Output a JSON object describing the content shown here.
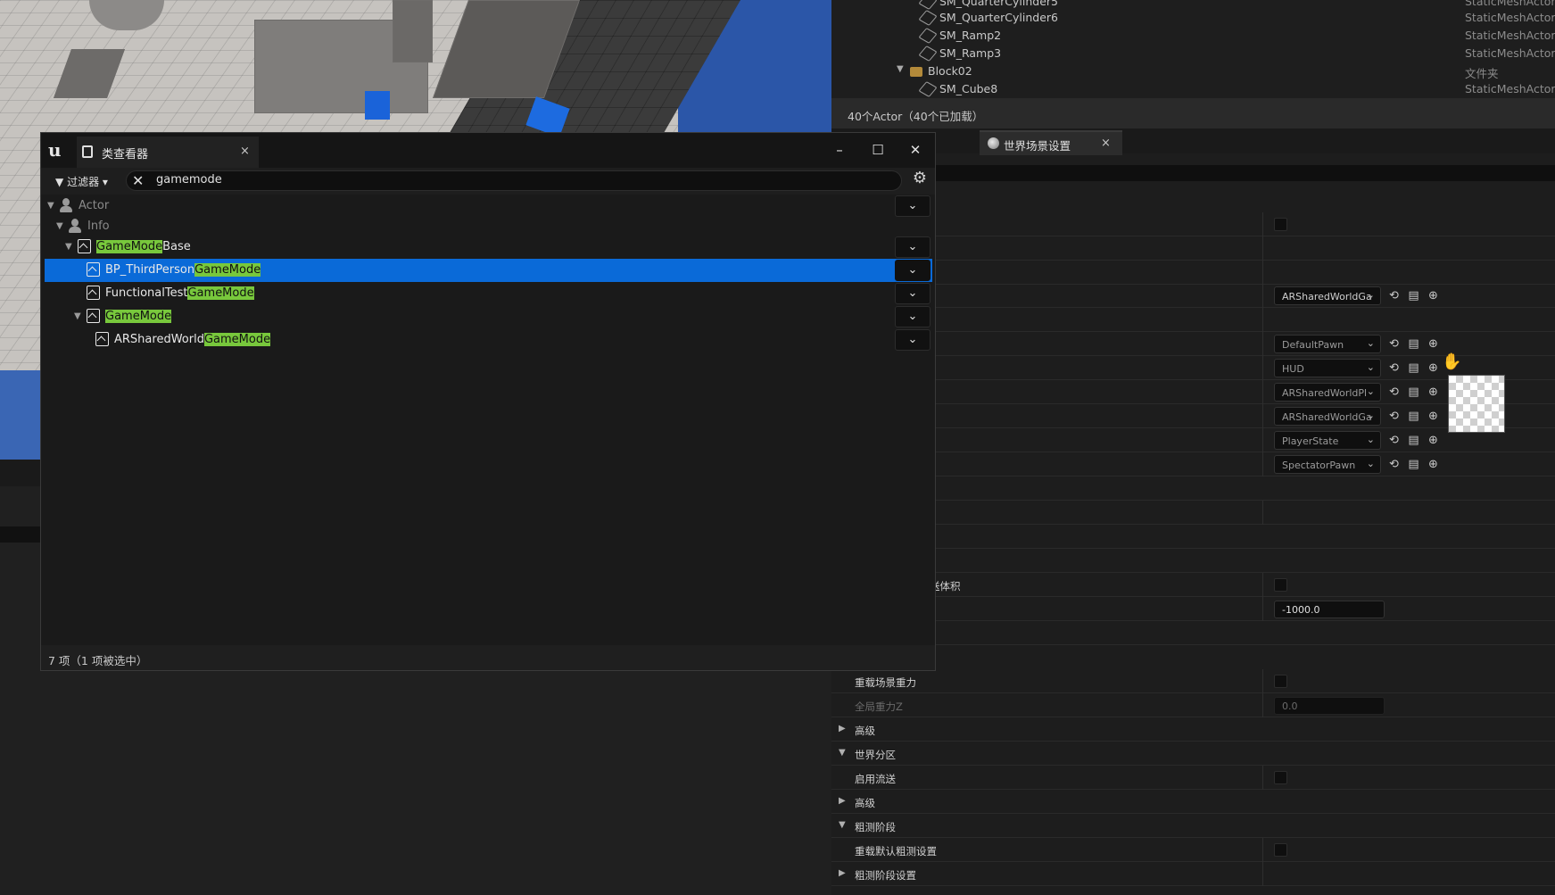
{
  "outliner": {
    "rows": [
      {
        "name": "SM_QuarterCylinder5",
        "type": "StaticMeshActor"
      },
      {
        "name": "SM_QuarterCylinder6",
        "type": "StaticMeshActor"
      },
      {
        "name": "SM_Ramp2",
        "type": "StaticMeshActor"
      },
      {
        "name": "SM_Ramp3",
        "type": "StaticMeshActor"
      },
      {
        "name": "Block02",
        "type": "文件夹"
      },
      {
        "name": "SM_Cube8",
        "type": "StaticMeshActor"
      }
    ],
    "footer": "40个Actor（40个已加载）"
  },
  "details": {
    "tab_label": "世界场景设置",
    "tab_close": "×",
    "combos": {
      "gamemode": "ARSharedWorldGa",
      "default_pawn": "DefaultPawn",
      "hud": "HUD",
      "player_controller": "ARSharedWorldPl",
      "game_state": "ARSharedWorldGa",
      "player_state": "PlayerState",
      "spectator_pawn": "SpectatorPawn"
    },
    "kill_volume_label": "送体积",
    "kill_z_value": "-1000.0",
    "override_gravity_label": "重载场景重力",
    "global_gravity_label": "全局重力Z",
    "global_gravity_value": "0.0",
    "advanced_label_1": "高级",
    "world_partition_label": "世界分区",
    "enable_streaming_label": "启用流送",
    "advanced_label_2": "高级",
    "coarse_label": "粗测阶段",
    "override_coarse_label": "重载默认粗测设置",
    "coarse_settings_label": "粗测阶段设置"
  },
  "class_viewer": {
    "title": "类查看器",
    "close": "×",
    "filter_label": "过滤器",
    "search_value": "gamemode",
    "tree": [
      {
        "pre": "Actor",
        "hl": "",
        "post": ""
      },
      {
        "pre": "Info",
        "hl": "",
        "post": ""
      },
      {
        "pre": "",
        "hl": "GameMode",
        "post": "Base"
      },
      {
        "pre": "BP_ThirdPerson",
        "hl": "GameMode",
        "post": ""
      },
      {
        "pre": "FunctionalTest",
        "hl": "GameMode",
        "post": ""
      },
      {
        "pre": "",
        "hl": "GameMode",
        "post": ""
      },
      {
        "pre": "ARSharedWorld",
        "hl": "GameMode",
        "post": ""
      }
    ],
    "status": "7 项（1 项被选中）"
  },
  "colors": {
    "selection": "#0a6ad8",
    "highlight": "#78c83c"
  }
}
